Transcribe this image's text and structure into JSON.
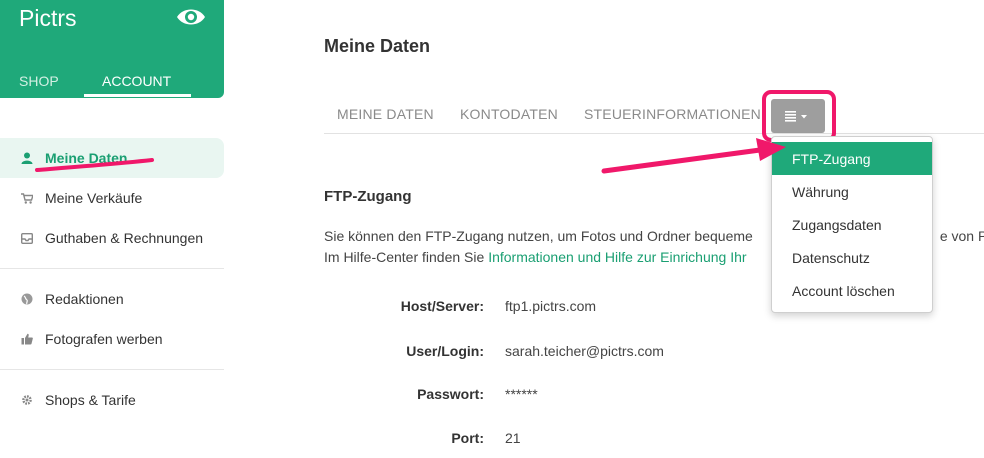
{
  "brand": {
    "name": "Pictrs",
    "eye_icon": "eye-icon"
  },
  "brand_tabs": {
    "shop": "SHOP",
    "account": "ACCOUNT"
  },
  "sidebar": {
    "items": [
      {
        "label": "Meine Daten",
        "icon": "user-icon"
      },
      {
        "label": "Meine Verkäufe",
        "icon": "cart-icon"
      },
      {
        "label": "Guthaben & Rechnungen",
        "icon": "inbox-icon"
      },
      {
        "label": "Redaktionen",
        "icon": "globe-icon"
      },
      {
        "label": "Fotografen werben",
        "icon": "thumbs-up-icon"
      },
      {
        "label": "Shops & Tarife",
        "icon": "gear-icon"
      }
    ]
  },
  "main": {
    "title": "Meine Daten",
    "tabs": [
      "MEINE DATEN",
      "KONTODATEN",
      "STEUERINFORMATIONEN"
    ],
    "section_title": "FTP-Zugang",
    "desc_line1": "Sie können den FTP-Zugang nutzen, um Fotos und Ordner bequeme",
    "desc_line1_tail": "e von Pi",
    "desc_line2_prefix": "Im Hilfe-Center finden Sie ",
    "desc_line2_link": "Informationen und Hilfe zur Einrichung Ihr",
    "fields": [
      {
        "label": "Host/Server:",
        "value": "ftp1.pictrs.com"
      },
      {
        "label": "User/Login:",
        "value": "sarah.teicher@pictrs.com"
      },
      {
        "label": "Passwort:",
        "value": "******"
      },
      {
        "label": "Port:",
        "value": "21"
      }
    ]
  },
  "dropdown": {
    "items": [
      "FTP-Zugang",
      "Währung",
      "Zugangsdaten",
      "Datenschutz",
      "Account löschen"
    ],
    "active_index": 0
  },
  "colors": {
    "brand_green": "#1fa97a",
    "highlight_pink": "#f0186a",
    "menu_button_gray": "#9e9e9e"
  }
}
